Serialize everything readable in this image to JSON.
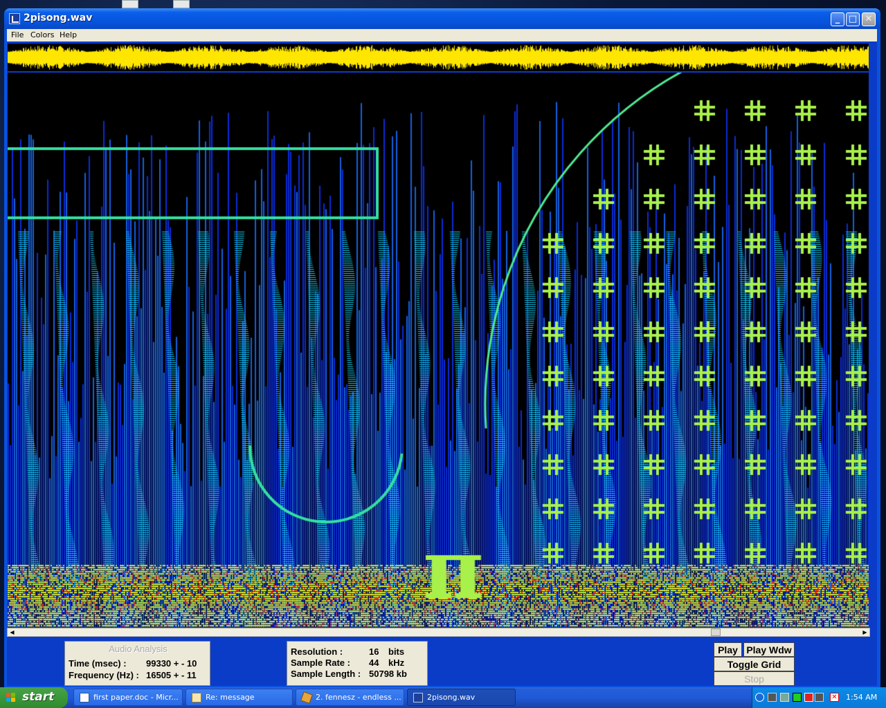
{
  "window": {
    "title": "2pisong.wav",
    "controls": {
      "minimize": "_",
      "maximize": "□",
      "close": "✕"
    }
  },
  "menu": [
    "File",
    "Colors",
    "Help"
  ],
  "analysis": {
    "title": "Audio Analysis",
    "time_label": "Time (msec) :",
    "time_value": "99330 + - 10",
    "freq_label": "Frequency (Hz) :",
    "freq_value": "16505 + - 11"
  },
  "info": {
    "resolution_label": "Resolution :",
    "resolution_value": "16",
    "resolution_unit": "bits",
    "rate_label": "Sample Rate :",
    "rate_value": "44",
    "rate_unit": "kHz",
    "length_label": "Sample Length :",
    "length_value": "50798 kb"
  },
  "buttons": {
    "play": "Play",
    "play_window": "Play Wdw",
    "toggle_grid": "Toggle Grid",
    "stop": "Stop"
  },
  "taskbar": {
    "start": "start",
    "tasks": [
      {
        "label": "first paper.doc - Micr...",
        "icon": "word-icon"
      },
      {
        "label": "Re: message",
        "icon": "mail-icon"
      },
      {
        "label": "2. fennesz - endless ...",
        "icon": "winamp-icon"
      },
      {
        "label": "2pisong.wav",
        "icon": "app-icon",
        "active": true
      }
    ],
    "clock": "1:54 AM"
  },
  "colors": {
    "waveform": "#ffe600",
    "spectro_low": "#0a2bd6",
    "spectro_mid": "#11c8e8",
    "spectro_high": "#a8f04a",
    "spectro_peak": "#ff3a10",
    "titlebar": "#0653dc"
  }
}
